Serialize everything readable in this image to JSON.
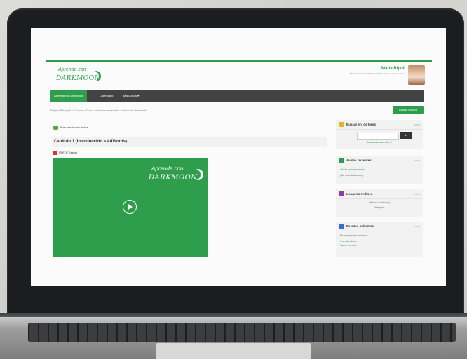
{
  "logo": {
    "line1": "Aprende con",
    "line2": "DARKMOON"
  },
  "user": {
    "name": "María Ripoll",
    "subtitle": "38 intentos de identificación fallidos desde su último acceso"
  },
  "nav": {
    "items": [
      {
        "label": "Aprende con DarkMoon"
      },
      {
        "label": "Calendario"
      },
      {
        "label": "Mis cursos ▾"
      }
    ]
  },
  "breadcrumb": "Página Principal > Cursos > Curso Iniciación avanzado > iniciación-avanzado",
  "edit_button": "Activar edición",
  "forum_link": "Foro resolución dudas",
  "chapter_title": "Capítulo 1 (Introducción a AdWords)",
  "pdf_label": "PDF 1º Sesión",
  "video": {
    "line1": "Aprende con",
    "line2": "DARKMOON"
  },
  "blocks": {
    "search": {
      "title": "Buscar en los foros",
      "button": "▸",
      "advanced": "Búsqueda avanzada ⓘ"
    },
    "news": {
      "title": "Avisos recientes",
      "link": "Añadir un nuevo tema...",
      "empty": "(Sin novedades aún)"
    },
    "online": {
      "title": "Usuarios en línea",
      "window": "(últimos 5 minutos)",
      "none": "Ninguno"
    },
    "events": {
      "title": "Eventos próximos",
      "empty": "No hay eventos próximos",
      "calendar": "Ir al calendario...",
      "new_event": "Nuevo evento..."
    }
  }
}
